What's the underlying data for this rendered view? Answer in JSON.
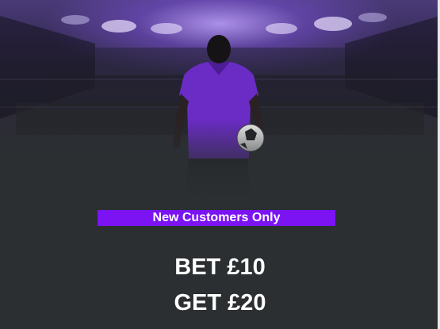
{
  "promo": {
    "badge_text": "New Customers Only",
    "offer_line_1": "BET £10",
    "offer_line_2": "GET £20"
  },
  "colors": {
    "badge_bg": "#7b13f2",
    "panel_bg": "#2b2f31",
    "jersey": "#6a2cc4",
    "text": "#ffffff"
  },
  "icons": {
    "hero": "football-player-stadium-image"
  }
}
